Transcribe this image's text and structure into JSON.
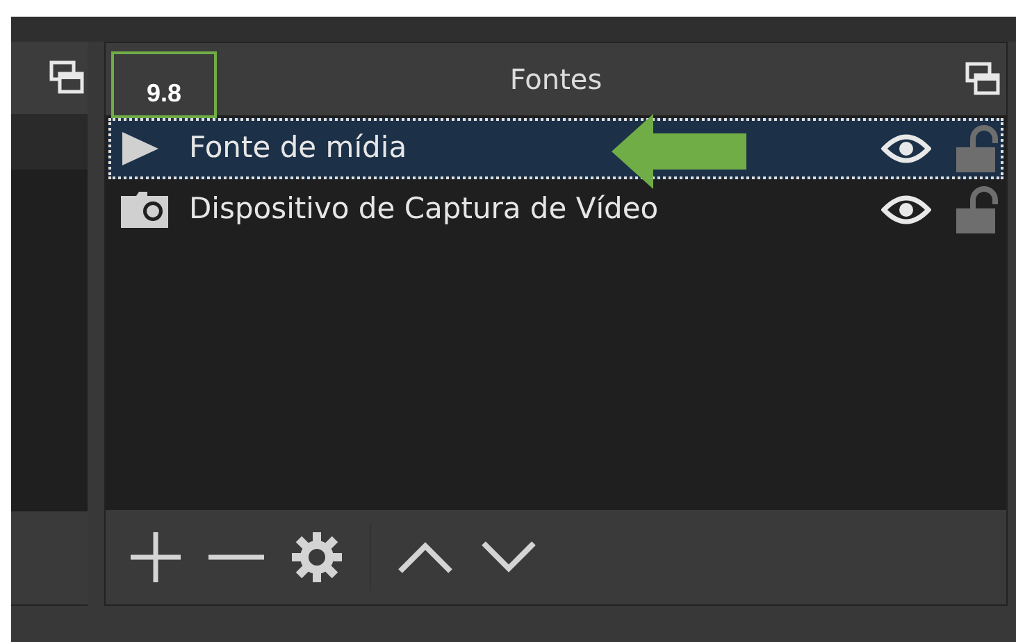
{
  "annotation": {
    "label": "9.8"
  },
  "panel": {
    "title": "Fontes"
  },
  "sources": [
    {
      "name": "Fonte de mídia",
      "kind": "media",
      "selected": true,
      "visible": true,
      "locked": false
    },
    {
      "name": "Dispositivo de Captura de Vídeo",
      "kind": "camera",
      "selected": false,
      "visible": true,
      "locked": false
    }
  ]
}
